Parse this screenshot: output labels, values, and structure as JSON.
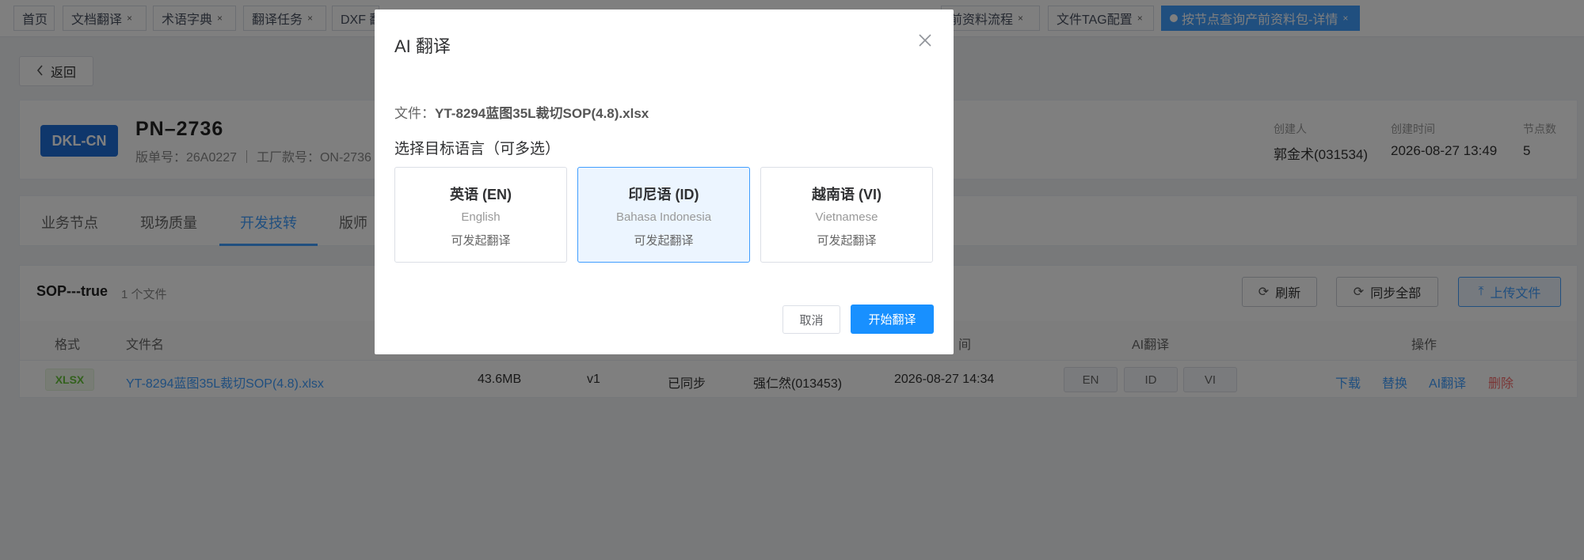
{
  "tabs": [
    {
      "label": "首页",
      "closable": false
    },
    {
      "label": "文档翻译",
      "closable": true
    },
    {
      "label": "术语字典",
      "closable": true
    },
    {
      "label": "翻译任务",
      "closable": true
    },
    {
      "label": "DXF 翻译",
      "closable": true
    },
    {
      "label": "前资料流程",
      "closable": true
    },
    {
      "label": "文件TAG配置",
      "closable": true
    },
    {
      "label": "按节点查询产前资料包-详情",
      "closable": true,
      "active": true
    }
  ],
  "tab_close_glyph": "×",
  "back_label": "返回",
  "header": {
    "badge": "DKL-CN",
    "pn": "PN–2736",
    "sub": "版单号：26A0227  ｜  工厂款号：ON-2736",
    "creator_label": "创建人",
    "creator_value": "郭金术(031534)",
    "created_label": "创建时间",
    "created_value": "2026-08-27 13:49",
    "nodes_label": "节点数",
    "nodes_value": "5"
  },
  "page_tabs": [
    {
      "label": "业务节点"
    },
    {
      "label": "现场质量"
    },
    {
      "label": "开发技转",
      "active": true
    },
    {
      "label": "版师"
    }
  ],
  "list": {
    "title": "SOP---true",
    "count": "1 个文件",
    "refresh_label": "刷新",
    "sync_label": "同步全部",
    "upload_label": "上传文件",
    "columns": {
      "format": "格式",
      "name": "文件名",
      "time": "间",
      "ai": "AI翻译",
      "ops": "操作"
    },
    "row": {
      "format": "XLSX",
      "name": "YT-8294蓝图35L裁切SOP(4.8).xlsx",
      "size": "43.6MB",
      "version": "v1",
      "sync": "已同步",
      "uploader": "强仁然(013453)",
      "time": "2026-08-27 14:34",
      "langs": [
        "EN",
        "ID",
        "VI"
      ],
      "ops": {
        "download": "下载",
        "replace": "替换",
        "ai": "AI翻译",
        "delete": "删除"
      }
    }
  },
  "modal": {
    "title": "AI 翻译",
    "close_glyph": "×",
    "file_prefix": "文件：",
    "file_name": "YT-8294蓝图35L裁切SOP(4.8).xlsx",
    "choose_label": "选择目标语言（可多选）",
    "languages": [
      {
        "name": "英语 (EN)",
        "native": "English",
        "status": "可发起翻译",
        "selected": false
      },
      {
        "name": "印尼语 (ID)",
        "native": "Bahasa Indonesia",
        "status": "可发起翻译",
        "selected": true
      },
      {
        "name": "越南语 (VI)",
        "native": "Vietnamese",
        "status": "可发起翻译",
        "selected": false
      }
    ],
    "cancel_label": "取消",
    "start_label": "开始翻译"
  },
  "icons": {
    "back": "chevron-left-icon",
    "refresh": "refresh-icon",
    "sync": "sync-icon",
    "upload": "upload-icon",
    "close": "close-icon"
  },
  "colors": {
    "primary": "#409eff",
    "badge": "#1e6fd9",
    "danger": "#f56c6c",
    "success": "#67c23a",
    "start_button": "#1890ff"
  }
}
